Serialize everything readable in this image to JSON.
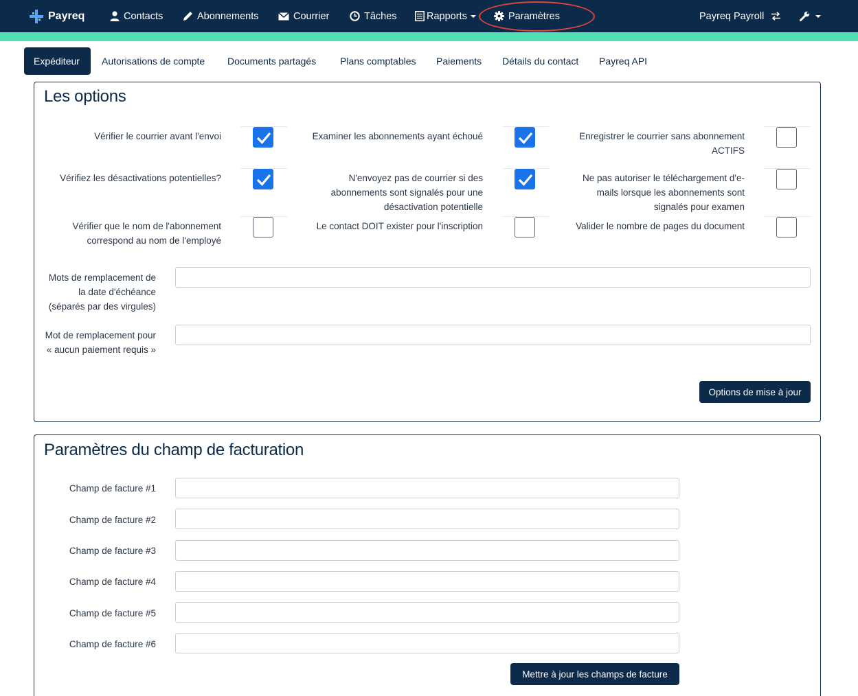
{
  "navbar": {
    "brand": "Payreq",
    "items": [
      {
        "label": "Contacts",
        "icon": "user-icon"
      },
      {
        "label": "Abonnements",
        "icon": "pencil-icon"
      },
      {
        "label": "Courrier",
        "icon": "envelope-icon"
      },
      {
        "label": "Tâches",
        "icon": "clock-icon"
      },
      {
        "label": "Rapports",
        "icon": "list-icon"
      },
      {
        "label": "Paramètres",
        "icon": "gear-icon"
      }
    ],
    "account": "Payreq Payroll",
    "colors": {
      "background": "#0c2a4a",
      "accent_bar": "#4fe0b6",
      "highlight_ring": "#e0453a"
    }
  },
  "tabs": [
    {
      "label": "Expéditeur",
      "active": true
    },
    {
      "label": "Autorisations de compte",
      "active": false
    },
    {
      "label": "Documents partagés",
      "active": false
    },
    {
      "label": "Plans comptables",
      "active": false
    },
    {
      "label": "Paiements",
      "active": false
    },
    {
      "label": "Détails du contact",
      "active": false
    },
    {
      "label": "Payreq API",
      "active": false
    }
  ],
  "options": {
    "title": "Les options",
    "checkboxes": [
      {
        "label": "Vérifier le courrier avant l'envoi",
        "checked": true
      },
      {
        "label": "Examiner les abonnements ayant échoué",
        "checked": true
      },
      {
        "label": "Enregistrer le courrier sans abonnement ACTIFS",
        "checked": false
      },
      {
        "label": "Vérifiez les désactivations potentielles?",
        "checked": true
      },
      {
        "label": "N'envoyez pas de courrier si des abonnements sont signalés pour une désactivation potentielle",
        "checked": true
      },
      {
        "label": "Ne pas autoriser le téléchargement d'e-mails lorsque les abonnements sont signalés pour examen",
        "checked": false
      },
      {
        "label": "Vérifier que le nom de l'abonnement correspond au nom de l'employé",
        "checked": false
      },
      {
        "label": "Le contact DOIT exister pour l'inscription",
        "checked": false
      },
      {
        "label": "Valider le nombre de pages du document",
        "checked": false
      }
    ],
    "due_date_words_label": "Mots de remplacement de la date d'échéance (séparés par des virgules)",
    "due_date_words_value": "",
    "no_payment_word_label": "Mot de remplacement pour « aucun paiement requis »",
    "no_payment_word_value": "",
    "update_button": "Options de mise à jour"
  },
  "billing": {
    "title": "Paramètres du champ de facturation",
    "fields": [
      {
        "label": "Champ de facture #1",
        "value": ""
      },
      {
        "label": "Champ de facture #2",
        "value": ""
      },
      {
        "label": "Champ de facture #3",
        "value": ""
      },
      {
        "label": "Champ de facture #4",
        "value": ""
      },
      {
        "label": "Champ de facture #5",
        "value": ""
      },
      {
        "label": "Champ de facture #6",
        "value": ""
      }
    ],
    "update_button": "Mettre à jour les champs de facture"
  }
}
